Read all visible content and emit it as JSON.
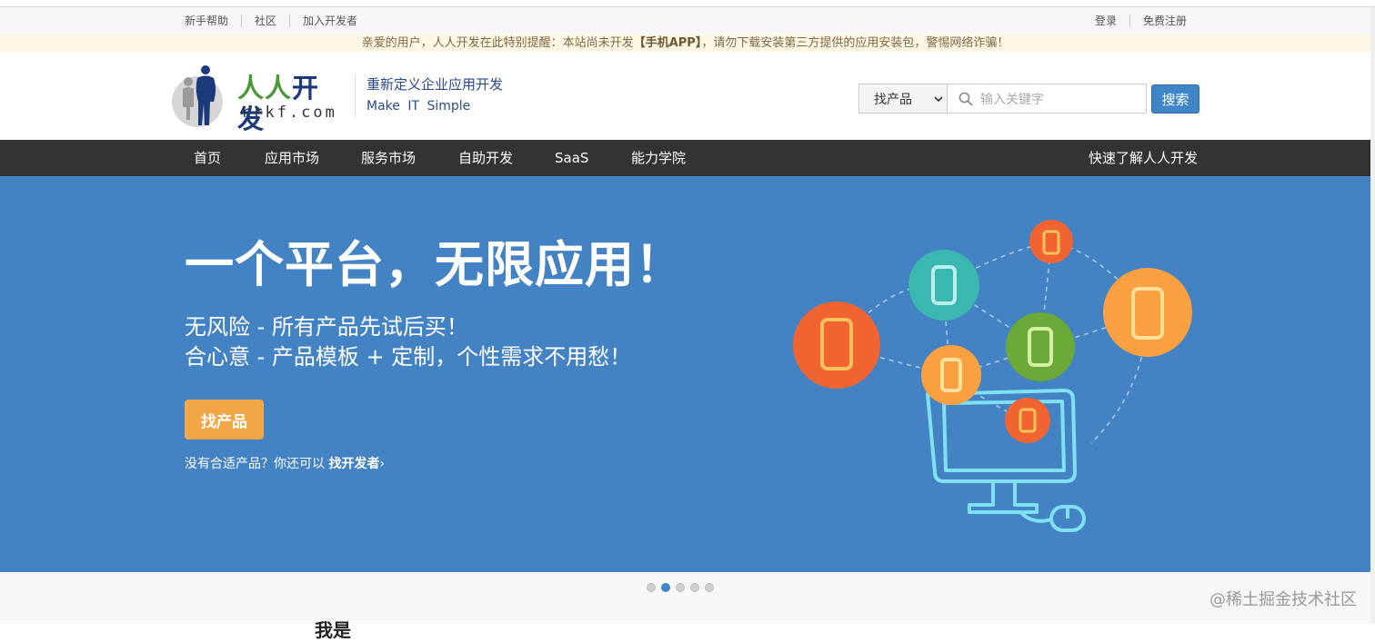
{
  "topbar": {
    "left_links": [
      "新手帮助",
      "社区",
      "加入开发者"
    ],
    "right_links": [
      "登录",
      "免费注册"
    ]
  },
  "notice": {
    "prefix": "亲爱的用户，人人开发在此特别提醒：本站尚未开发",
    "highlight": "【手机APP】",
    "suffix": "，请勿下载安装第三方提供的应用安装包，警惕网络诈骗！"
  },
  "brand": {
    "name_cn": "人人开发",
    "name_en": "rrkf.com",
    "slogan_cn": "重新定义企业应用开发",
    "slogan_en": "Make  IT  Simple"
  },
  "search": {
    "category": "找产品",
    "placeholder": "输入关键字",
    "button": "搜索"
  },
  "nav": {
    "items": [
      "首页",
      "应用市场",
      "服务市场",
      "自助开发",
      "SaaS",
      "能力学院"
    ],
    "right": "快速了解人人开发"
  },
  "banner": {
    "headline": "一个平台，无限应用！",
    "line1": "无风险 - 所有产品先试后买！",
    "line2": "合心意 - 产品模板 + 定制，个性需求不用愁！",
    "cta": "找产品",
    "dev_prefix": "没有合适产品？你还可以",
    "dev_link": "找开发者",
    "dev_arrow": "›"
  },
  "carousel": {
    "count": 5,
    "active": 2
  },
  "section": {
    "title": "我是"
  },
  "watermark": "@稀土掘金技术社区",
  "colors": {
    "nav_bg": "#333333",
    "banner_bg": "#4483c3",
    "cta": "#f2a646",
    "button_blue": "#3f86c8"
  }
}
